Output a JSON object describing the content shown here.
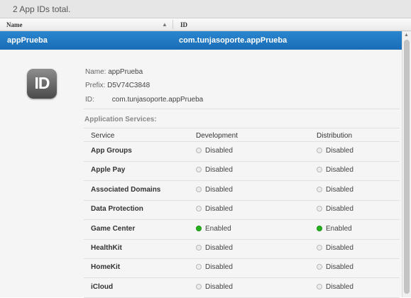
{
  "header": {
    "count_text": "2  App IDs total."
  },
  "table": {
    "columns": {
      "name": "Name",
      "id": "ID"
    },
    "sort_indicator": "▲",
    "selected_row": {
      "name": "appPrueba",
      "id": "com.tunjasoporte.appPrueba"
    }
  },
  "details": {
    "icon_text": "ID",
    "name_label": "Name:",
    "name_value": "appPrueba",
    "prefix_label": "Prefix:",
    "prefix_value": "D5V74C3848",
    "id_label": "ID:",
    "id_value": "com.tunjasoporte.appPrueba",
    "services_title": "Application Services:",
    "services_headers": {
      "service": "Service",
      "development": "Development",
      "distribution": "Distribution"
    },
    "services": [
      {
        "name": "App Groups",
        "development": "Disabled",
        "distribution": "Disabled"
      },
      {
        "name": "Apple Pay",
        "development": "Disabled",
        "distribution": "Disabled"
      },
      {
        "name": "Associated Domains",
        "development": "Disabled",
        "distribution": "Disabled"
      },
      {
        "name": "Data Protection",
        "development": "Disabled",
        "distribution": "Disabled"
      },
      {
        "name": "Game Center",
        "development": "Enabled",
        "distribution": "Enabled"
      },
      {
        "name": "HealthKit",
        "development": "Disabled",
        "distribution": "Disabled"
      },
      {
        "name": "HomeKit",
        "development": "Disabled",
        "distribution": "Disabled"
      },
      {
        "name": "iCloud",
        "development": "Disabled",
        "distribution": "Disabled"
      }
    ]
  },
  "colors": {
    "selection": "#1a6db6",
    "enabled": "#25b31c",
    "disabled": "#ececec"
  }
}
